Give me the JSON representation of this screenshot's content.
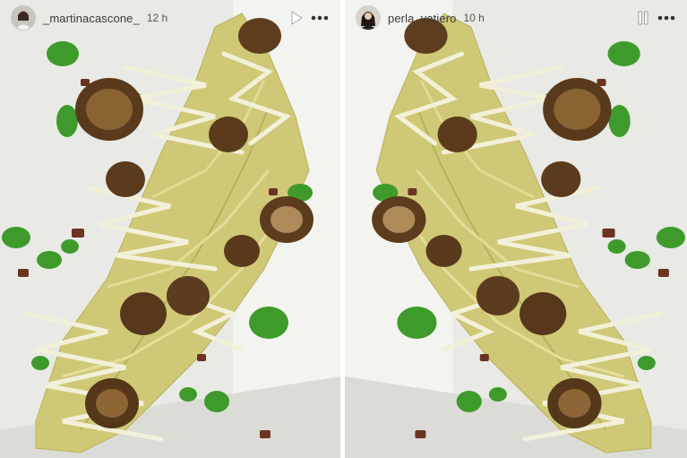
{
  "stories": [
    {
      "username": "_martinacascone_",
      "timestamp": "12 h",
      "avatar_icon": "avatar-woman-profile-icon",
      "control_icon": "play-icon",
      "more_icon": "more-horizontal-icon"
    },
    {
      "username": "perla_vatiero",
      "timestamp": "10 h",
      "avatar_icon": "avatar-woman-profile-icon",
      "control_icon": "pause-icon",
      "more_icon": "more-horizontal-icon"
    }
  ],
  "colors": {
    "plate": "#eeeeea",
    "pasta": "#d2cc7a",
    "sauce": "#3d9a2a",
    "cream": "#f2efd8",
    "zucchini": "#5e3c1f",
    "ui_text": "#3a3a3a"
  }
}
